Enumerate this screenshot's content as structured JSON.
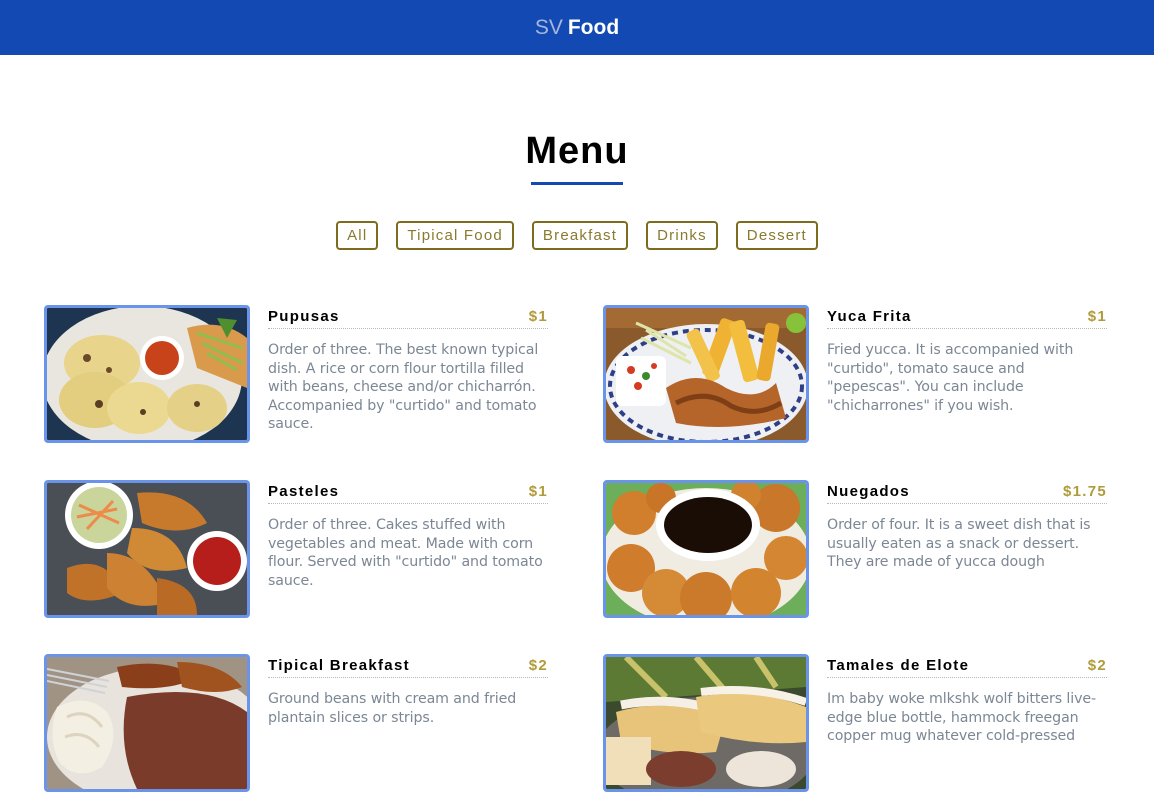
{
  "nav": {
    "brand_prefix": "SV",
    "brand_name": "Food"
  },
  "page": {
    "title": "Menu"
  },
  "filters": [
    "All",
    "Tipical Food",
    "Breakfast",
    "Drinks",
    "Dessert"
  ],
  "items": [
    {
      "name": "Pupusas",
      "price": "$1",
      "description": "Order of three. The best known typical dish. A rice or corn flour tortilla filled with beans, cheese and/or chicharrón. Accompanied by \"curtido\" and tomato sauce.",
      "image_icon": "pupusas-photo"
    },
    {
      "name": "Yuca Frita",
      "price": "$1",
      "description": "Fried yucca. It is accompanied with \"curtido\", tomato sauce and \"pepescas\". You can include \"chicharrones\" if you wish.",
      "image_icon": "yuca-frita-photo"
    },
    {
      "name": "Pasteles",
      "price": "$1",
      "description": "Order of three. Cakes stuffed with vegetables and meat. Made with corn flour. Served with \"curtido\" and tomato sauce.",
      "image_icon": "pasteles-photo"
    },
    {
      "name": "Nuegados",
      "price": "$1.75",
      "description": "Order of four. It is a sweet dish that is usually eaten as a snack or dessert. They are made of yucca dough",
      "image_icon": "nuegados-photo"
    },
    {
      "name": "Tipical Breakfast",
      "price": "$2",
      "description": "Ground beans with cream and fried plantain slices or strips.",
      "image_icon": "breakfast-photo"
    },
    {
      "name": "Tamales de Elote",
      "price": "$2",
      "description": "Im baby woke mlkshk wolf bitters live-edge blue bottle, hammock freegan copper mug whatever cold-pressed",
      "image_icon": "tamales-photo"
    }
  ],
  "colors": {
    "navbar": "#1349b3",
    "accent_gold": "#b09b3a",
    "filter_border": "#7d6c1e",
    "photo_border": "#6a94ea",
    "description_text": "#7b8794"
  }
}
